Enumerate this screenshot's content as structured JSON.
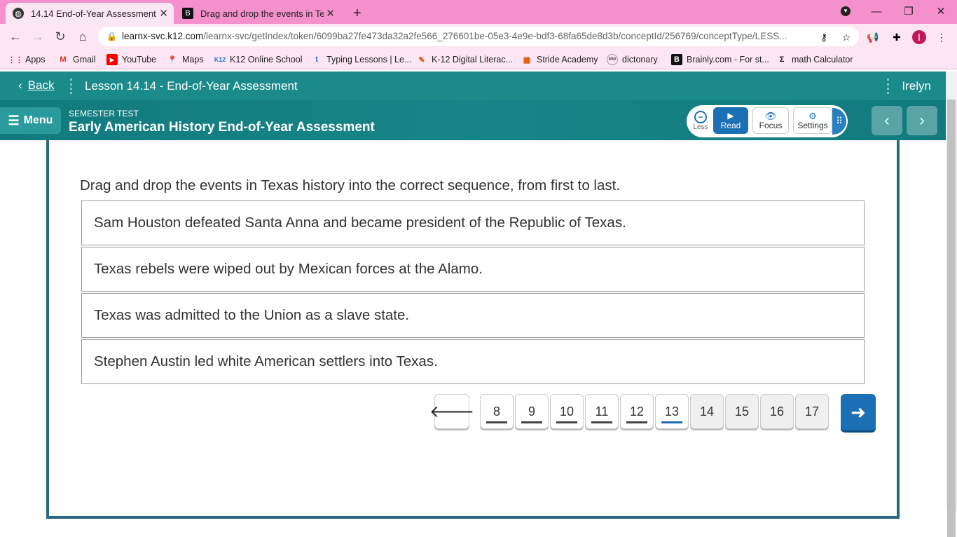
{
  "browser": {
    "tabs": [
      {
        "title": "14.14 End-of-Year Assessment",
        "icon": "globe-icon"
      },
      {
        "title": "Drag and drop the events in Texa",
        "icon": "brainly-icon"
      }
    ],
    "url_main": "learnx-svc.k12.com",
    "url_rest": "/learnx-svc/getIndex/token/6099ba27fe473da32a2fe566_276601be-05e3-4e9e-bdf3-68fa65de8d3b/conceptId/256769/conceptType/LESS...",
    "profile_initial": "I",
    "bookmarks": [
      "Apps",
      "Gmail",
      "YouTube",
      "Maps",
      "K12 Online School",
      "Typing Lessons | Le...",
      "K-12 Digital Literac...",
      "Stride Academy",
      "dictonary",
      "Brainly.com - For st...",
      "math Calculator"
    ]
  },
  "header": {
    "back_label": "Back",
    "lesson_title": "Lesson 14.14 - End-of-Year Assessment",
    "user_name": "Irelyn",
    "menu_label": "Menu",
    "test_type": "SEMESTER TEST",
    "course_title": "Early American History End-of-Year Assessment",
    "tools": {
      "less": "Less",
      "read": "Read",
      "focus": "Focus",
      "settings": "Settings"
    }
  },
  "question": {
    "prompt": "Drag and drop the events in Texas history into the correct sequence, from first to last.",
    "items": [
      "Sam Houston defeated Santa Anna and became president of the Republic of Texas.",
      "Texas rebels were wiped out by Mexican forces at the Alamo.",
      "Texas was admitted to the Union as a slave state.",
      "Stephen Austin led white American settlers into Texas."
    ]
  },
  "pager": {
    "pages": [
      "8",
      "9",
      "10",
      "11",
      "12",
      "13",
      "14",
      "15",
      "16",
      "17"
    ],
    "current": "13",
    "colors": {
      "accent": "#1b6fb5",
      "teal": "#1b8a8a",
      "chrome": "#f490cc"
    }
  }
}
